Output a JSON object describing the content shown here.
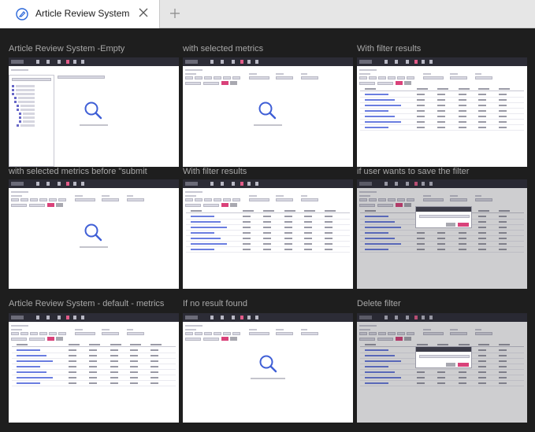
{
  "tab": {
    "title": "Article Review System",
    "icon": "figma-logo-icon",
    "close_icon": "close-icon",
    "add_icon": "plus-icon"
  },
  "colors": {
    "accent": "#d9427a",
    "link": "#6a7de0",
    "canvas": "#1e1e1e",
    "frame_topbar": "#2c2c36"
  },
  "frames": [
    {
      "label": "Article Review System -Empty",
      "variant": "tree-empty"
    },
    {
      "label": "with selected metrics",
      "variant": "empty"
    },
    {
      "label": "With filter results",
      "variant": "results"
    },
    {
      "label": "with selected metrics before \"submit",
      "variant": "empty2"
    },
    {
      "label": "With filter results",
      "variant": "results"
    },
    {
      "label": "if user wants to save the filter",
      "variant": "dialog-save"
    },
    {
      "label": "Article Review System - default - metrics",
      "variant": "default"
    },
    {
      "label": "If no result found",
      "variant": "noresult"
    },
    {
      "label": "Delete filter",
      "variant": "dialog-delete"
    }
  ]
}
